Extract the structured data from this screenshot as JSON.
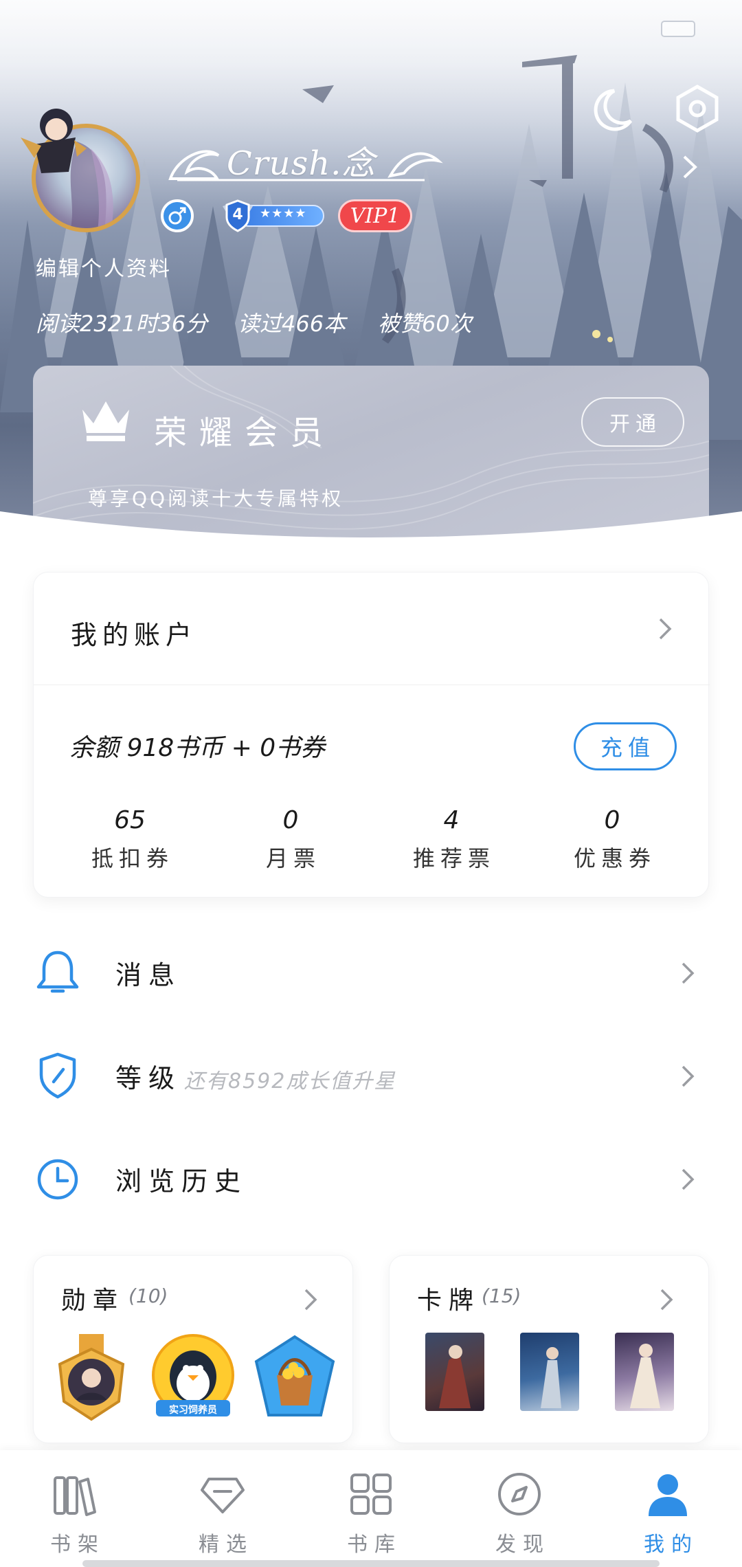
{
  "colors": {
    "accent": "#2f8ee6",
    "vip_red": "#f0474b",
    "muted_text": "#b7b9be",
    "nav_inactive": "#8a8d93"
  },
  "header": {
    "username": "Crush.念",
    "level": "4",
    "level_stars": "★★★★",
    "vip_label": "VIP1",
    "edit_profile": "编辑个人资料",
    "stats": [
      {
        "text": "阅读2321时36分"
      },
      {
        "text": "读过466本"
      },
      {
        "text": "被赞60次"
      }
    ],
    "icons": [
      "moon-icon",
      "settings-icon",
      "chevron-right-icon"
    ]
  },
  "vip_card": {
    "title": "荣耀会员",
    "open_button": "开通",
    "description": "尊享QQ阅读十大专属特权"
  },
  "account": {
    "title": "我的账户",
    "balance": "余额  918书币 + 0书券",
    "recharge_button": "充值",
    "metrics": [
      {
        "value": "65",
        "label": "抵扣券"
      },
      {
        "value": "0",
        "label": "月票"
      },
      {
        "value": "4",
        "label": "推荐票"
      },
      {
        "value": "0",
        "label": "优惠券"
      }
    ]
  },
  "menu": {
    "messages": {
      "label": "消息",
      "icon": "bell-icon"
    },
    "level": {
      "label": "等级",
      "sub": "还有8592成长值升星",
      "icon": "shield-icon"
    },
    "history": {
      "label": "浏览历史",
      "icon": "clock-icon"
    }
  },
  "medals": {
    "title": "勋章",
    "count": "(10)",
    "items": [
      {
        "name": "gold-medal"
      },
      {
        "name": "penguin-medal",
        "caption": "实习饲养员"
      },
      {
        "name": "treasure-medal"
      }
    ]
  },
  "cards": {
    "title": "卡牌",
    "count": "(15)"
  },
  "bottom_nav": {
    "items": [
      {
        "label": "书架",
        "icon": "bookshelf-icon"
      },
      {
        "label": "精选",
        "icon": "diamond-icon"
      },
      {
        "label": "书库",
        "icon": "grid-icon"
      },
      {
        "label": "发现",
        "icon": "compass-icon"
      },
      {
        "label": "我的",
        "icon": "user-icon",
        "active": true
      }
    ]
  }
}
